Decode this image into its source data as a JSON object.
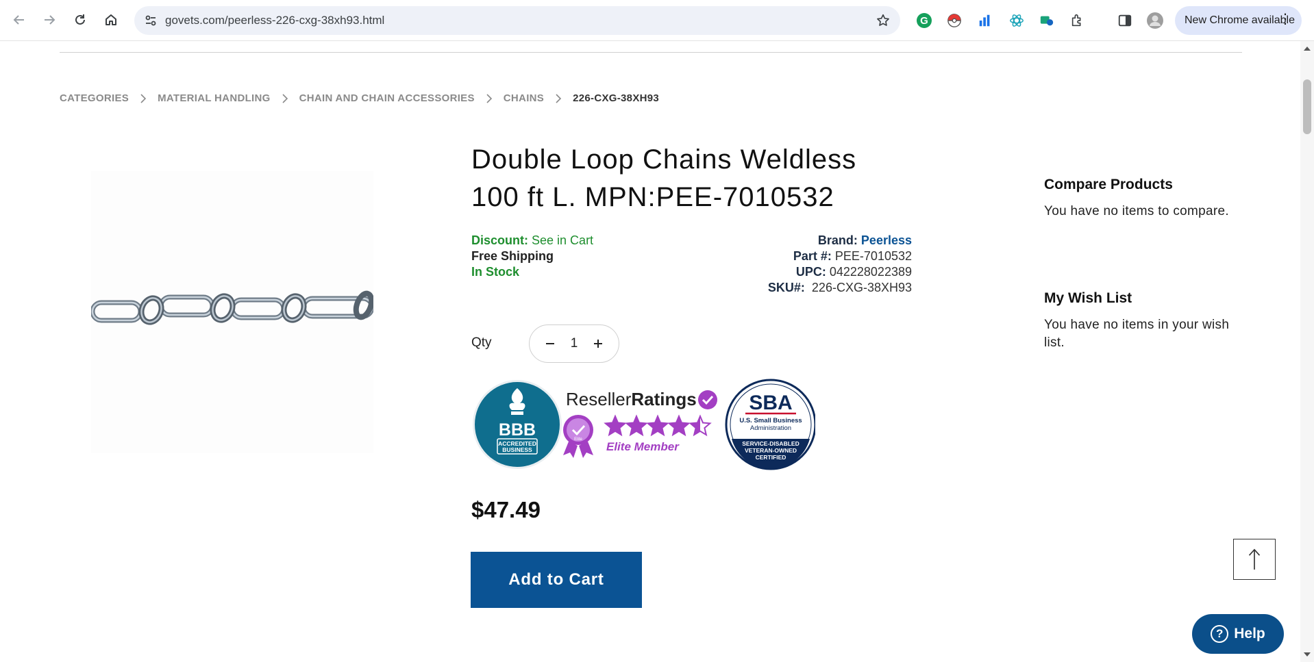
{
  "browser": {
    "url": "govets.com/peerless-226-cxg-38xh93.html",
    "update_label": "New Chrome available",
    "icons": [
      "back-icon",
      "forward-icon",
      "reload-icon",
      "home-icon",
      "site-settings-icon",
      "bookmark-star-icon",
      "grammarly-extension-icon",
      "pokeball-extension-icon",
      "chart-extension-icon",
      "atom-extension-icon",
      "image-extension-icon",
      "extensions-puzzle-icon",
      "side-panel-icon",
      "profile-avatar",
      "more-menu-icon"
    ]
  },
  "breadcrumb": [
    "CATEGORIES",
    "MATERIAL HANDLING",
    "CHAIN AND CHAIN ACCESSORIES",
    "CHAINS",
    "226-CXG-38XH93"
  ],
  "product": {
    "title": "Double Loop Chains Weldless 100 ft L. MPN:PEE-7010532",
    "discount_label": "Discount:",
    "discount_value": "See in Cart",
    "shipping": "Free Shipping",
    "stock": "In Stock",
    "brand_label": "Brand:",
    "brand_value": "Peerless",
    "part_label": "Part #:",
    "part_value": "PEE-7010532",
    "upc_label": "UPC:",
    "upc_value": "042228022389",
    "sku_label": "SKU#:",
    "sku_value": "226-CXG-38XH93",
    "qty_label": "Qty",
    "qty_value": "1",
    "price": "$47.49",
    "add_to_cart": "Add to Cart"
  },
  "badges": {
    "bbb_main": "BBB",
    "bbb_sub1": "ACCREDITED",
    "bbb_sub2": "BUSINESS",
    "rr_brand_prefix": "Reseller",
    "rr_brand_suffix": "Ratings",
    "rr_member": "Elite Member",
    "rr_ribbon": "Elite",
    "rr_rating": 4.5,
    "rr_rating_max": 5,
    "sba_logo": "SBA",
    "sba_line1": "U.S. Small Business",
    "sba_line2": "Administration",
    "sba_cert1": "SERVICE-DISABLED",
    "sba_cert2": "VETERAN-OWNED",
    "sba_cert3": "CERTIFIED"
  },
  "sidebar": {
    "compare_title": "Compare Products",
    "compare_text": "You have no items to compare.",
    "wishlist_title": "My Wish List",
    "wishlist_text": "You have no items in your wish list."
  },
  "help_label": "Help",
  "colors": {
    "brand_blue": "#0b5394",
    "stock_green": "#1e8e2e",
    "bbb_teal": "#0f6e8e",
    "rr_purple": "#a33fc3",
    "sba_navy": "#0d2a5a"
  }
}
